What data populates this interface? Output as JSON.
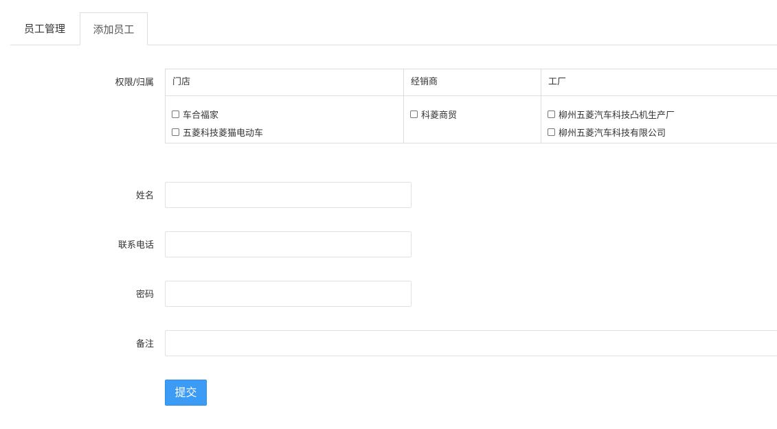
{
  "tabs": [
    {
      "label": "员工管理"
    },
    {
      "label": "添加员工"
    }
  ],
  "form": {
    "permission_label": "权限/归属",
    "permission_table": {
      "columns": [
        {
          "header": "门店",
          "items": [
            {
              "label": "车合福家",
              "checked": false
            },
            {
              "label": "五菱科技菱猫电动车",
              "checked": false
            }
          ]
        },
        {
          "header": "经销商",
          "items": [
            {
              "label": "科菱商贸",
              "checked": false
            }
          ]
        },
        {
          "header": "工厂",
          "items": [
            {
              "label": "柳州五菱汽车科技凸机生产厂",
              "checked": false
            },
            {
              "label": "柳州五菱汽车科技有限公司",
              "checked": false
            }
          ]
        }
      ]
    },
    "name_label": "姓名",
    "name_value": "",
    "phone_label": "联系电话",
    "phone_value": "",
    "password_label": "密码",
    "password_value": "",
    "note_label": "备注",
    "note_value": "",
    "submit_label": "提交"
  },
  "colors": {
    "primary": "#3c9cf5",
    "border": "#dddddd"
  }
}
